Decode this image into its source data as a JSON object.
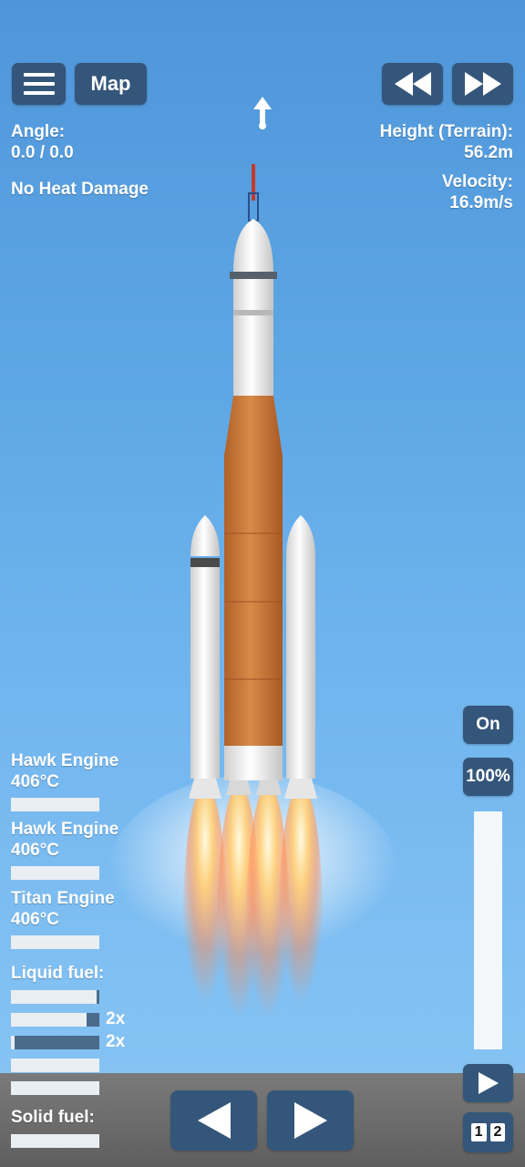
{
  "toolbar": {
    "menu_icon": "hamburger-icon",
    "map_label": "Map",
    "rewind_icon": "rewind-icon",
    "forward_icon": "fast-forward-icon"
  },
  "left_info": {
    "angle_label": "Angle:",
    "angle_value": "0.0 / 0.0",
    "heat": "No Heat Damage"
  },
  "right_info": {
    "height_label": "Height (Terrain):",
    "height_value": "56.2m",
    "velocity_label": "Velocity:",
    "velocity_value": "16.9m/s"
  },
  "direction_icon": "up-arrow-icon",
  "engines": [
    {
      "name": "Hawk Engine",
      "temp": "406°C"
    },
    {
      "name": "Hawk Engine",
      "temp": "406°C"
    },
    {
      "name": "Titan Engine",
      "temp": "406°C"
    }
  ],
  "liquid_fuel": {
    "label": "Liquid fuel:",
    "tanks": [
      {
        "fill": 0.97,
        "multiplier": ""
      },
      {
        "fill": 0.86,
        "multiplier": "2x"
      },
      {
        "fill": 0.04,
        "multiplier": "2x"
      },
      {
        "fill": 1.0,
        "multiplier": ""
      },
      {
        "fill": 1.0,
        "multiplier": ""
      }
    ]
  },
  "solid_fuel": {
    "label": "Solid fuel:"
  },
  "throttle": {
    "on_label": "On",
    "percent": "100%",
    "level": 1.0
  },
  "controls": {
    "left_icon": "rotate-left-icon",
    "right_icon": "rotate-right-icon",
    "play_icon": "play-icon",
    "stage_1": "1",
    "stage_2": "2"
  },
  "colors": {
    "button": "#34567a",
    "orange_tank": "#c9783d",
    "sky_top": "#4f96d9",
    "sky_bottom": "#8ac6f4"
  }
}
